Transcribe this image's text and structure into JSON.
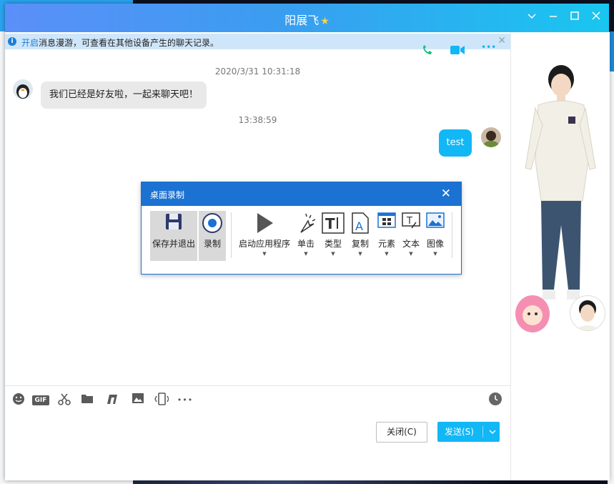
{
  "window": {
    "title": "阳展飞"
  },
  "notice": {
    "link": "开启",
    "text": "消息漫游，可查看在其他设备产生的聊天记录。"
  },
  "messages": [
    {
      "timestamp": "2020/3/31 10:31:18",
      "text": "我们已经是好友啦，一起来聊天吧！",
      "side": "left"
    },
    {
      "timestamp": "13:38:59",
      "text": "test",
      "side": "right"
    }
  ],
  "recorder": {
    "title": "桌面录制",
    "items": [
      {
        "label": "保存并退出",
        "icon": "floppy-icon"
      },
      {
        "label": "录制",
        "icon": "record-icon"
      },
      {
        "label": "启动应用程序",
        "icon": "play-icon"
      },
      {
        "label": "单击",
        "icon": "click-icon"
      },
      {
        "label": "类型",
        "icon": "text-type-icon"
      },
      {
        "label": "复制",
        "icon": "copy-icon"
      },
      {
        "label": "元素",
        "icon": "element-icon"
      },
      {
        "label": "文本",
        "icon": "text-icon"
      },
      {
        "label": "图像",
        "icon": "image-icon"
      }
    ]
  },
  "toolbar": {
    "gif": "GIF",
    "more": "•••"
  },
  "buttons": {
    "close": "关闭(C)",
    "send": "发送(S)"
  },
  "colors": {
    "accent": "#12b7f5",
    "title_gradient_start": "#5b8ff9",
    "recorder_title": "#1b72d2"
  }
}
